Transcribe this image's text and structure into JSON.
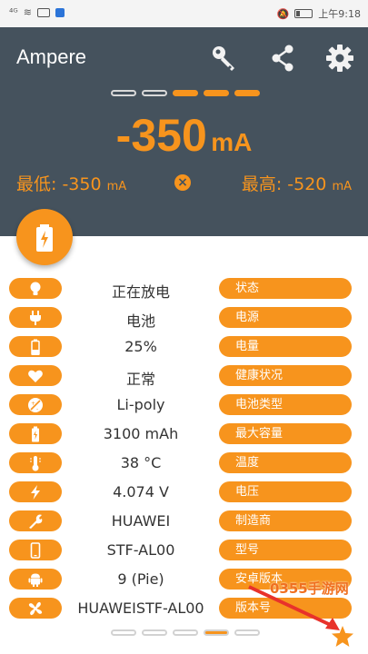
{
  "status_bar": {
    "signal": "⁴ᴳ",
    "time": "上午9:18"
  },
  "header": {
    "app_title": "Ampere",
    "current_value": "-350",
    "current_unit": "mA",
    "min_label": "最低: -350",
    "min_unit": "mA",
    "max_label": "最高: -520",
    "max_unit": "mA",
    "pager_top_active": [
      false,
      false,
      true,
      true,
      true
    ]
  },
  "rows": [
    {
      "icon": "bulb-icon",
      "value": "正在放电",
      "label": "状态"
    },
    {
      "icon": "plug-icon",
      "value": "电池",
      "label": "电源"
    },
    {
      "icon": "battery-level-icon",
      "value": "25%",
      "label": "电量"
    },
    {
      "icon": "heart-icon",
      "value": "正常",
      "label": "健康状况"
    },
    {
      "icon": "battery-type-icon",
      "value": "Li-poly",
      "label": "电池类型"
    },
    {
      "icon": "capacity-icon",
      "value": "3100 mAh",
      "label": "最大容量"
    },
    {
      "icon": "thermometer-icon",
      "value": "38 °C",
      "label": "温度"
    },
    {
      "icon": "bolt-icon",
      "value": "4.074 V",
      "label": "电压"
    },
    {
      "icon": "wrench-icon",
      "value": "HUAWEI",
      "label": "制造商"
    },
    {
      "icon": "phone-icon",
      "value": "STF-AL00",
      "label": "型号"
    },
    {
      "icon": "android-icon",
      "value": "9 (Pie)",
      "label": "安卓版本"
    },
    {
      "icon": "fan-icon",
      "value": "HUAWEISTF-AL00",
      "label": "版本号"
    }
  ],
  "pager_bottom_active": [
    false,
    false,
    false,
    true,
    false
  ],
  "watermark": "0355手游网",
  "colors": {
    "accent": "#f7941d",
    "header_bg": "#45525d",
    "annotation_arrow": "#e8322b"
  }
}
